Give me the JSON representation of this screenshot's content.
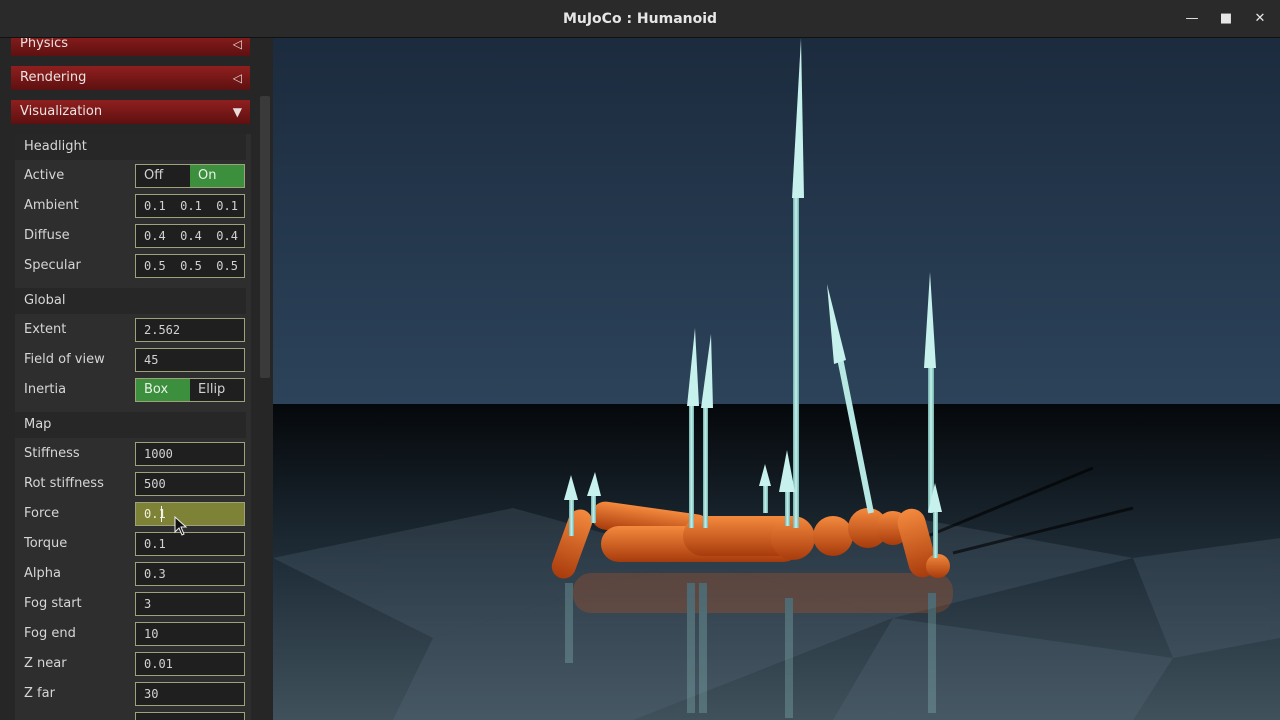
{
  "window": {
    "title": "MuJoCo : Humanoid",
    "minimize_icon": "minimize-icon",
    "maximize_icon": "maximize-icon",
    "close_icon": "close-icon"
  },
  "sections": {
    "physics": "Physics",
    "rendering": "Rendering",
    "visualization": "Visualization"
  },
  "headlight": {
    "title": "Headlight",
    "active_label": "Active",
    "active_options": [
      "Off",
      "On"
    ],
    "active_selected": "On",
    "ambient_label": "Ambient",
    "ambient_value": "0.1  0.1  0.1",
    "diffuse_label": "Diffuse",
    "diffuse_value": "0.4  0.4  0.4",
    "specular_label": "Specular",
    "specular_value": "0.5  0.5  0.5"
  },
  "global": {
    "title": "Global",
    "extent_label": "Extent",
    "extent_value": "2.562",
    "fov_label": "Field of view",
    "fov_value": "45",
    "inertia_label": "Inertia",
    "inertia_options": [
      "Box",
      "Ellip"
    ],
    "inertia_selected": "Box"
  },
  "map": {
    "title": "Map",
    "stiffness_label": "Stiffness",
    "stiffness_value": "1000",
    "rot_stiffness_label": "Rot stiffness",
    "rot_stiffness_value": "500",
    "force_label": "Force",
    "force_value": "0.1",
    "torque_label": "Torque",
    "torque_value": "0.1",
    "alpha_label": "Alpha",
    "alpha_value": "0.3",
    "fog_start_label": "Fog start",
    "fog_start_value": "3",
    "fog_end_label": "Fog end",
    "fog_end_value": "10",
    "znear_label": "Z near",
    "znear_value": "0.01",
    "zfar_label": "Z far",
    "zfar_value": "30"
  },
  "colors": {
    "section_header": "#8f1f1f",
    "toggle_selected": "#3b8f3d",
    "active_field": "#7d8236",
    "body": "#d8591a",
    "arrows": "#9fdcd6"
  }
}
